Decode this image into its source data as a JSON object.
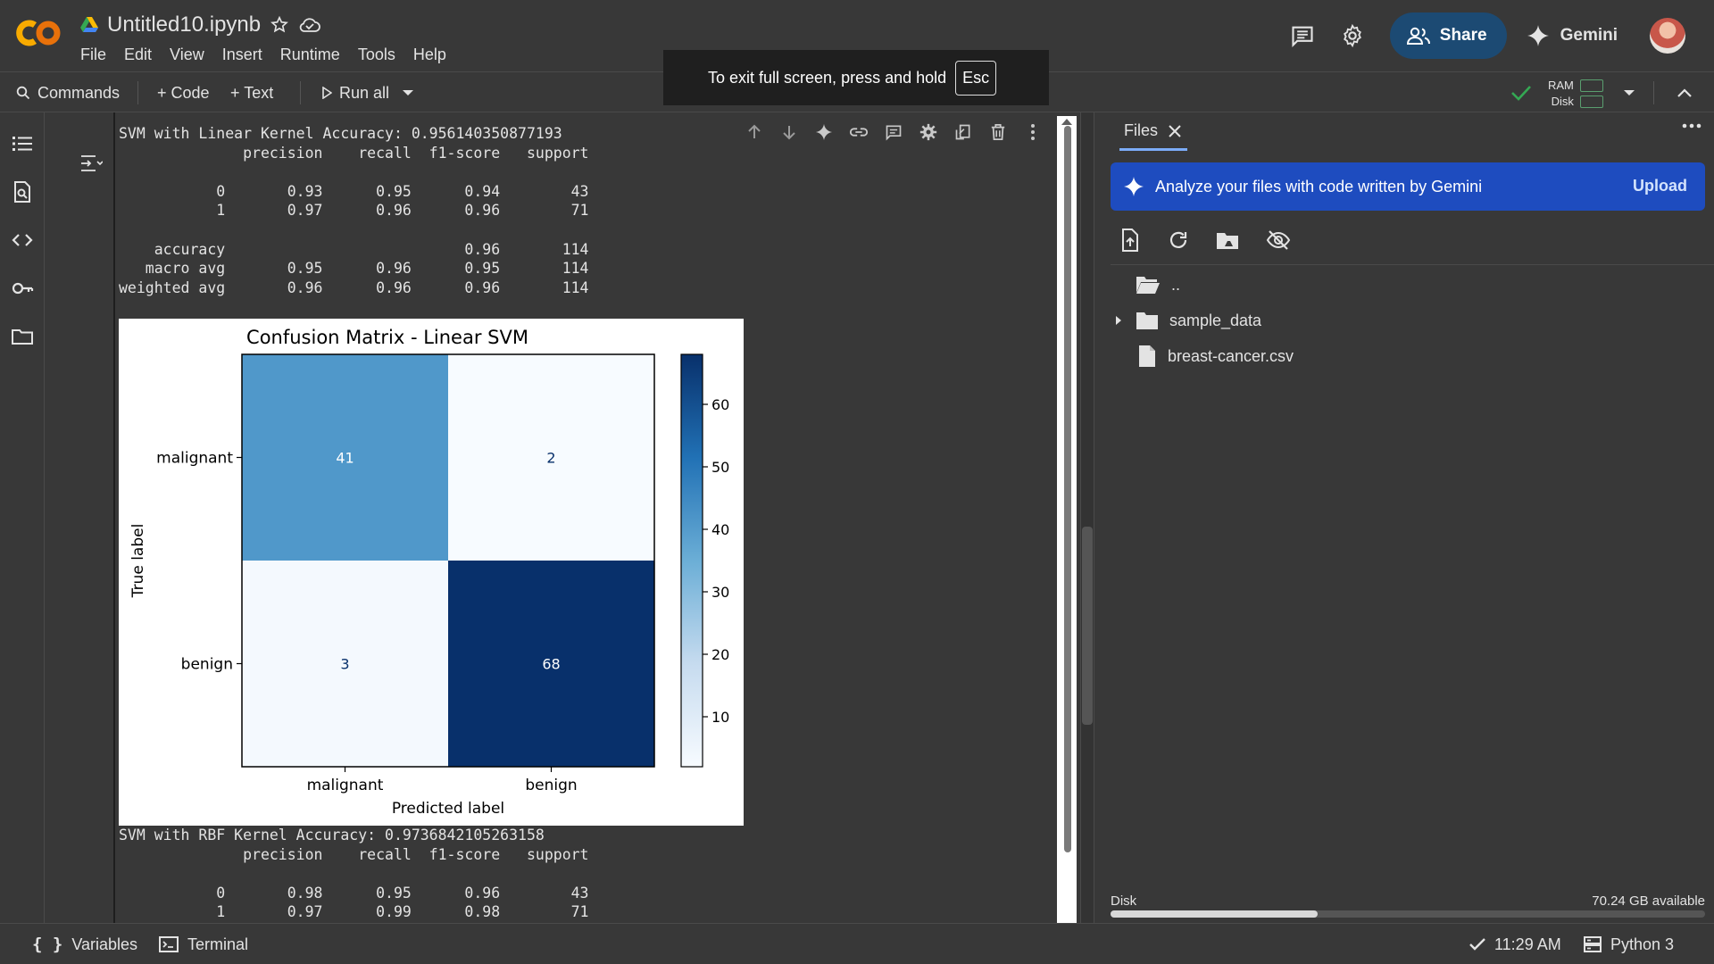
{
  "app": {
    "notebook_title": "Untitled10.ipynb",
    "menu": [
      "File",
      "Edit",
      "View",
      "Insert",
      "Runtime",
      "Tools",
      "Help"
    ],
    "share_label": "Share",
    "gemini_label": "Gemini"
  },
  "toolbar": {
    "commands_label": "Commands",
    "code_label": "+ Code",
    "text_label": "+ Text",
    "run_all_label": "Run all",
    "ram_label": "RAM",
    "disk_label": "Disk"
  },
  "toast": {
    "message": "To exit full screen, press and hold",
    "key": "Esc"
  },
  "output": {
    "linear_report": "SVM with Linear Kernel Accuracy: 0.956140350877193\n              precision    recall  f1-score   support\n\n           0       0.93      0.95      0.94        43\n           1       0.97      0.96      0.96        71\n\n    accuracy                           0.96       114\n   macro avg       0.95      0.96      0.95       114\nweighted avg       0.96      0.96      0.96       114",
    "rbf_report": "SVM with RBF Kernel Accuracy: 0.9736842105263158\n              precision    recall  f1-score   support\n\n           0       0.98      0.95      0.96        43\n           1       0.97      0.99      0.98        71"
  },
  "chart_data": {
    "type": "heatmap",
    "title": "Confusion Matrix - Linear SVM",
    "xlabel": "Predicted label",
    "ylabel": "True label",
    "x_categories": [
      "malignant",
      "benign"
    ],
    "y_categories": [
      "malignant",
      "benign"
    ],
    "values": [
      [
        41,
        2
      ],
      [
        3,
        68
      ]
    ],
    "colormap": "Blues",
    "colorbar_range": [
      2,
      68
    ],
    "colorbar_ticks": [
      10,
      20,
      30,
      40,
      50,
      60
    ]
  },
  "files": {
    "tab_label": "Files",
    "banner_text": "Analyze your files with code written by Gemini",
    "upload_label": "Upload",
    "items": [
      {
        "name": "..",
        "type": "parent-folder"
      },
      {
        "name": "sample_data",
        "type": "folder"
      },
      {
        "name": "breast-cancer.csv",
        "type": "file"
      }
    ],
    "disk_label": "Disk",
    "disk_available": "70.24 GB available",
    "disk_used_fraction": 0.35
  },
  "status": {
    "variables_label": "Variables",
    "terminal_label": "Terminal",
    "time": "11:29 AM",
    "runtime": "Python 3"
  }
}
